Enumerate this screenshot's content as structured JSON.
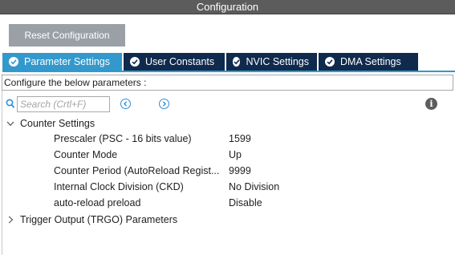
{
  "window": {
    "title": "Configuration"
  },
  "toolbar": {
    "reset_label": "Reset Configuration"
  },
  "tabs": [
    {
      "label": "Parameter Settings",
      "active": true,
      "icon": "check-circle-icon"
    },
    {
      "label": "User Constants",
      "active": false,
      "icon": "check-circle-icon"
    },
    {
      "label": "NVIC Settings",
      "active": false,
      "icon": "check-circle-icon"
    },
    {
      "label": "DMA Settings",
      "active": false,
      "icon": "check-circle-icon"
    }
  ],
  "panel": {
    "header": "Configure the below parameters :"
  },
  "search": {
    "placeholder": "Search (Crtl+F)"
  },
  "groups": [
    {
      "label": "Counter Settings",
      "expanded": true,
      "params": [
        {
          "name": "Prescaler (PSC - 16 bits value)",
          "value": "1599"
        },
        {
          "name": "Counter Mode",
          "value": "Up"
        },
        {
          "name": "Counter Period (AutoReload Regist...",
          "value": "9999"
        },
        {
          "name": "Internal Clock Division (CKD)",
          "value": "No Division"
        },
        {
          "name": "auto-reload preload",
          "value": "Disable"
        }
      ]
    },
    {
      "label": "Trigger Output (TRGO) Parameters",
      "expanded": false,
      "params": []
    }
  ],
  "colors": {
    "titlebar": "#5c5c5c",
    "tab_active": "#3399cc",
    "tab_inactive": "#0f2a4d",
    "button": "#9aa0a6",
    "nav_accent": "#2f8ed6"
  }
}
